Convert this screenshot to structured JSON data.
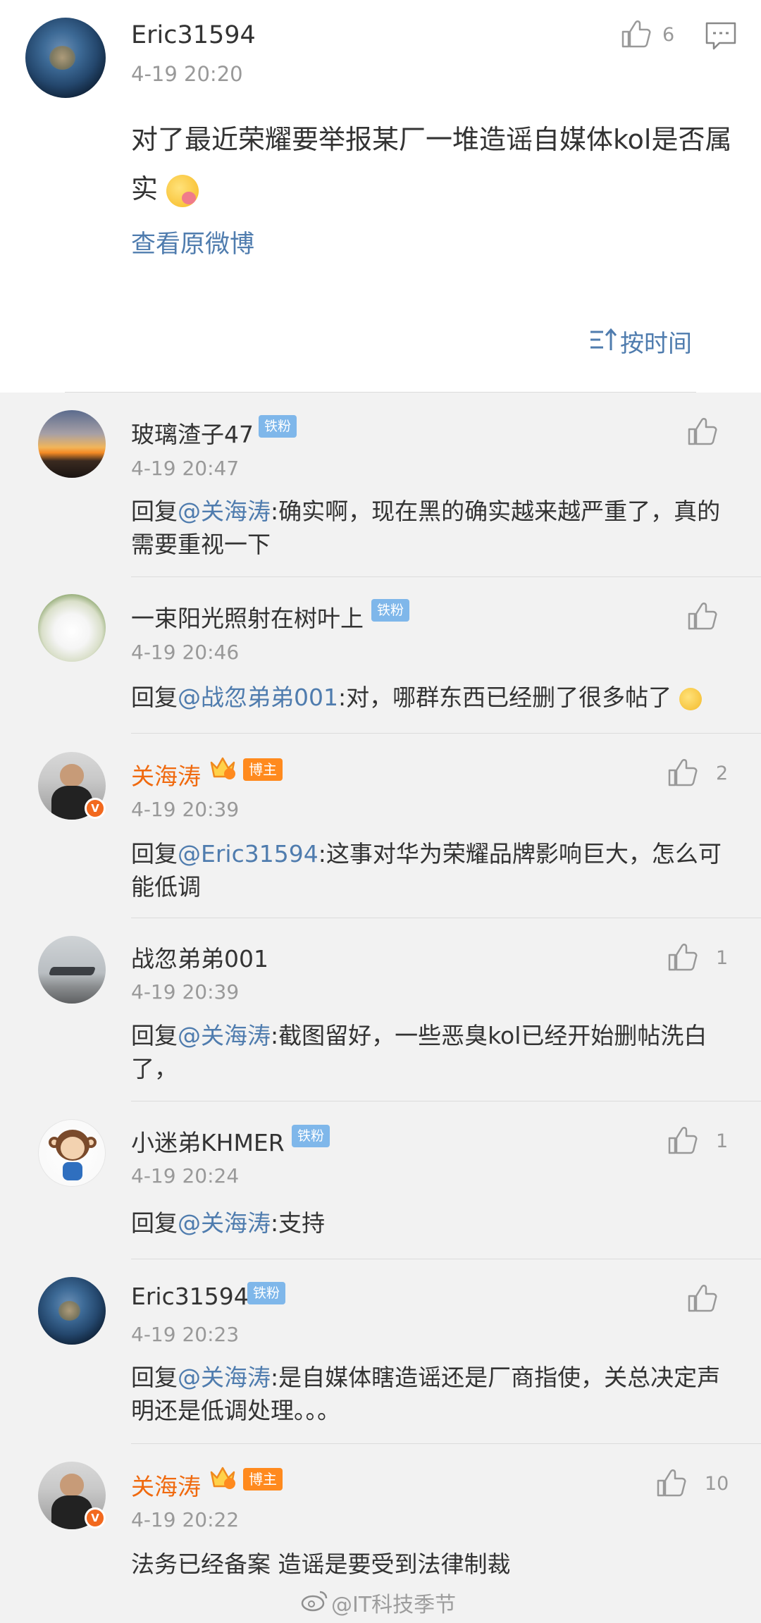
{
  "main_post": {
    "username": "Eric31594",
    "time": "4-19 20:20",
    "like_count": "6",
    "text": "对了最近荣耀要举报某厂一堆造谣自媒体kol是否属实",
    "view_original": "查看原微博",
    "sort_label": "按时间"
  },
  "comments": [
    {
      "username": "玻璃渣子47",
      "badge": "铁粉",
      "time": "4-19 20:47",
      "reply_prefix": "回复",
      "mention": "@关海涛",
      "text": ":确实啊，现在黑的确实越来越严重了，真的需要重视一下",
      "like_count": ""
    },
    {
      "username": "一束阳光照射在树叶上",
      "badge": "铁粉",
      "time": "4-19 20:46",
      "reply_prefix": "回复",
      "mention": "@战忽弟弟001",
      "text": ":对，哪群东西已经删了很多帖了",
      "like_count": ""
    },
    {
      "username": "关海涛",
      "badge": "博主",
      "time": "4-19 20:39",
      "reply_prefix": "回复",
      "mention": "@Eric31594",
      "text": ":这事对华为荣耀品牌影响巨大，怎么可能低调",
      "like_count": "2"
    },
    {
      "username": "战忽弟弟001",
      "badge": "",
      "time": "4-19 20:39",
      "reply_prefix": "回复",
      "mention": "@关海涛",
      "text": ":截图留好，一些恶臭kol已经开始删帖洗白了，",
      "like_count": "1"
    },
    {
      "username": "小迷弟KHMER",
      "badge": "铁粉",
      "time": "4-19 20:24",
      "reply_prefix": "回复",
      "mention": "@关海涛",
      "text": ":支持",
      "like_count": "1"
    },
    {
      "username": "Eric31594",
      "badge": "铁粉",
      "time": "4-19 20:23",
      "reply_prefix": "回复",
      "mention": "@关海涛",
      "text": ":是自媒体瞎造谣还是厂商指使，关总决定声明还是低调处理。。。",
      "like_count": ""
    },
    {
      "username": "关海涛",
      "badge": "博主",
      "time": "4-19 20:22",
      "reply_prefix": "",
      "mention": "",
      "text": "法务已经备案 造谣是要受到法律制裁",
      "like_count": "10"
    }
  ],
  "watermark": "@IT科技季节",
  "colors": {
    "link": "#4f7cae",
    "author": "#f06a0f",
    "fan_badge": "#7fb7ea",
    "host_badge": "#ff8a1e"
  }
}
